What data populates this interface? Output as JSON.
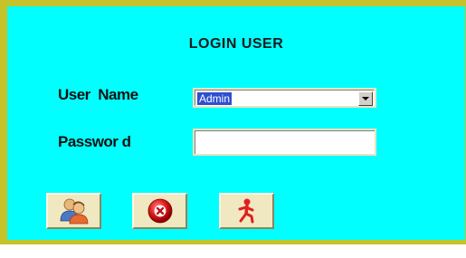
{
  "dialog": {
    "title": "LOGIN USER",
    "user_label": "User  Name",
    "password_label": "Passwor d"
  },
  "user_combo": {
    "selected": "Admin"
  },
  "password_field": {
    "value": ""
  },
  "buttons": {
    "login_icon": "users-icon",
    "cancel_icon": "cancel-x-icon",
    "exit_icon": "running-man-icon"
  },
  "colors": {
    "frame": "#c6c229",
    "panel": "#00ffff",
    "button_face": "#f0e8c0",
    "selection": "#2f4fd0"
  }
}
